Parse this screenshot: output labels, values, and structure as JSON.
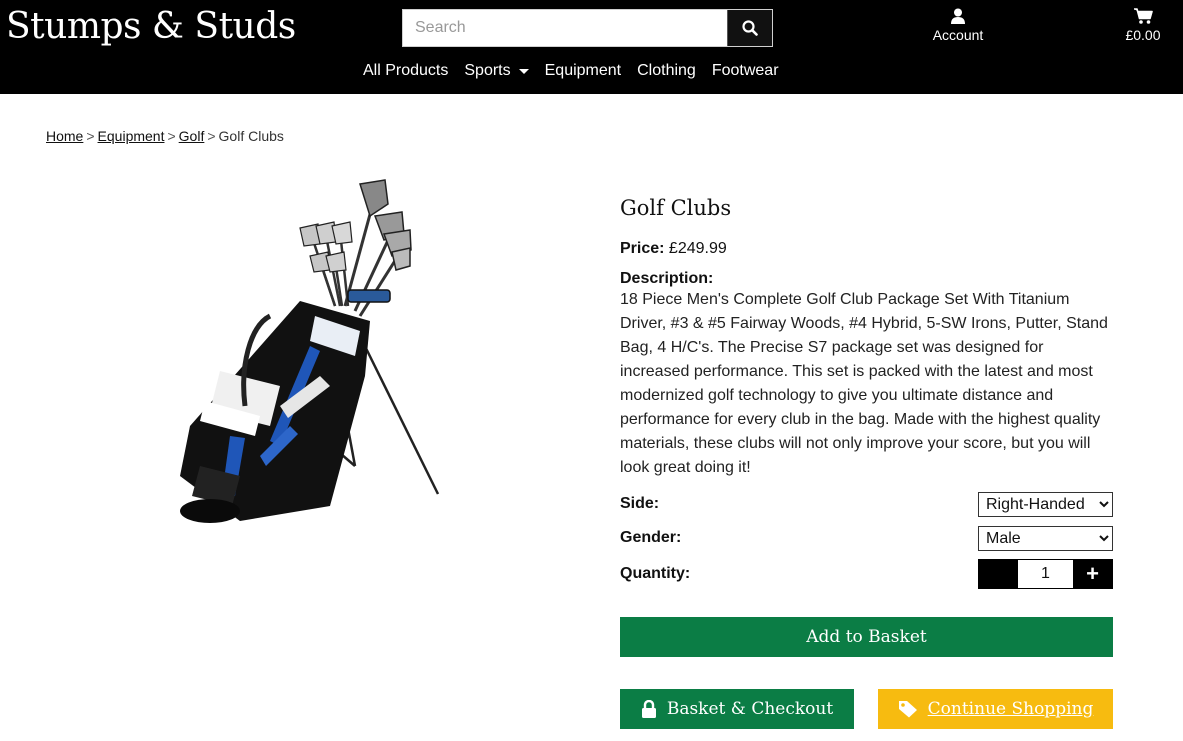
{
  "header": {
    "brand": "Stumps & Studs",
    "search_placeholder": "Search",
    "search_icon": "search-icon",
    "account_label": "Account",
    "account_icon": "user-icon",
    "basket_total": "£0.00",
    "basket_icon": "cart-icon"
  },
  "nav": {
    "items": [
      {
        "label": "All Products"
      },
      {
        "label": "Sports",
        "dropdown": true
      },
      {
        "label": "Equipment"
      },
      {
        "label": "Clothing"
      },
      {
        "label": "Footwear"
      }
    ]
  },
  "breadcrumb": {
    "items": [
      "Home",
      "Equipment",
      "Golf"
    ],
    "current": "Golf Clubs",
    "separator": ">"
  },
  "product": {
    "title": "Golf Clubs",
    "price_label": "Price:",
    "price": "£249.99",
    "description_label": "Description:",
    "description": "18 Piece Men's Complete Golf Club Package Set With Titanium Driver, #3 & #5 Fairway Woods, #4 Hybrid, 5-SW Irons, Putter, Stand Bag, 4 H/C's. The Precise S7 package set was designed for increased performance. This set is packed with the latest and most modernized golf technology to give you ultimate distance and performance for every club in the bag. Made with the highest quality materials, these clubs will not only improve your score, but you will look great doing it!",
    "side_label": "Side:",
    "side_value": "Right-Handed",
    "gender_label": "Gender:",
    "gender_value": "Male",
    "quantity_label": "Quantity:",
    "quantity_value": "1"
  },
  "actions": {
    "add_to_basket": "Add to Basket",
    "checkout": "Basket & Checkout",
    "checkout_icon": "lock-icon",
    "continue": "Continue Shopping",
    "continue_icon": "tag-icon"
  },
  "colors": {
    "header_bg": "#000000",
    "primary_green": "#0b7d45",
    "accent_yellow": "#f7bb10"
  }
}
